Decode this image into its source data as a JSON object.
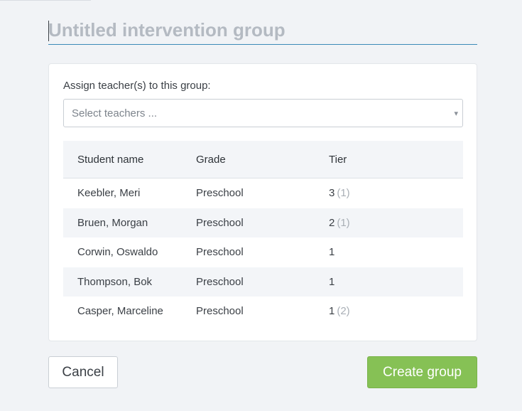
{
  "group": {
    "name_value": "",
    "name_placeholder": "Untitled intervention group"
  },
  "assign": {
    "label": "Assign teacher(s) to this group:",
    "select_placeholder": "Select teachers ...",
    "arrow_icon": "▾"
  },
  "table": {
    "headers": [
      "Student name",
      "Grade",
      "Tier"
    ],
    "rows": [
      {
        "name": "Keebler, Meri",
        "grade": "Preschool",
        "tier": "3",
        "tier_extra": "(1)"
      },
      {
        "name": "Bruen, Morgan",
        "grade": "Preschool",
        "tier": "2",
        "tier_extra": "(1)"
      },
      {
        "name": "Corwin, Oswaldo",
        "grade": "Preschool",
        "tier": "1",
        "tier_extra": ""
      },
      {
        "name": "Thompson, Bok",
        "grade": "Preschool",
        "tier": "1",
        "tier_extra": ""
      },
      {
        "name": "Casper, Marceline",
        "grade": "Preschool",
        "tier": "1",
        "tier_extra": "(2)"
      }
    ]
  },
  "actions": {
    "cancel_label": "Cancel",
    "create_label": "Create group"
  },
  "colors": {
    "accent": "#3b8ab8",
    "primary_button": "#86c155",
    "row_alt": "#f3f5f8",
    "background": "#f1f3f6"
  }
}
